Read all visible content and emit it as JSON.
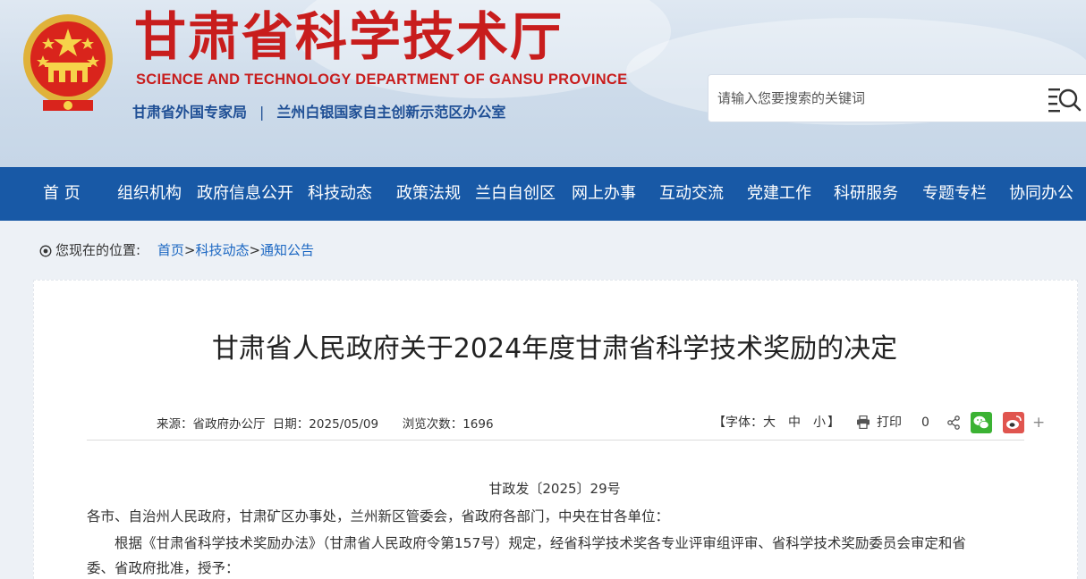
{
  "header": {
    "title": "甘肃省科学技术厅",
    "subtitle_en": "SCIENCE AND TECHNOLOGY DEPARTMENT OF GANSU PROVINCE",
    "affiliation_1": "甘肃省外国专家局",
    "affiliation_sep": "|",
    "affiliation_2": "兰州白银国家自主创新示范区办公室",
    "emblem_icon": "national-emblem-icon"
  },
  "search": {
    "placeholder": "请输入您要搜索的关键词",
    "value": "",
    "button_icon": "search-icon"
  },
  "nav": {
    "items": [
      "首 页",
      "组织机构",
      "政府信息公开",
      "科技动态",
      "政策法规",
      "兰白自创区",
      "网上办事",
      "互动交流",
      "党建工作",
      "科研服务",
      "专题专栏",
      "协同办公"
    ]
  },
  "breadcrumb": {
    "label": "您现在的位置:",
    "links": [
      "首页",
      "科技动态",
      "通知公告"
    ],
    "separator": ">"
  },
  "article": {
    "title": "甘肃省人民政府关于2024年度甘肃省科学技术奖励的决定",
    "source": "来源：省政府办公厅",
    "date": "日期：2025/05/09",
    "views": "浏览次数：1696",
    "doc_number": "甘政发〔2025〕29号",
    "addressees": "各市、自治州人民政府，甘肃矿区办事处，兰州新区管委会，省政府各部门，中央在甘各单位：",
    "body_line1": "根据《甘肃省科学技术奖励办法》（甘肃省人民政府令第157号）规定，经省科学技术奖各专业评审组评审、省科学技术奖励委员会审定和省",
    "body_line2": "委、省政府批准，授予："
  },
  "tools": {
    "font_label_open": "【字体：",
    "font_large": "大",
    "font_medium": "中",
    "font_small": "小",
    "font_label_close": "】",
    "print_label": "打印",
    "share_count": "0",
    "more": "+"
  },
  "colors": {
    "brand_red": "#c81d1d",
    "nav_blue": "#1859a6",
    "link_blue": "#1a66c2",
    "wechat_green": "#3bb233",
    "weibo_red": "#e0554f"
  }
}
